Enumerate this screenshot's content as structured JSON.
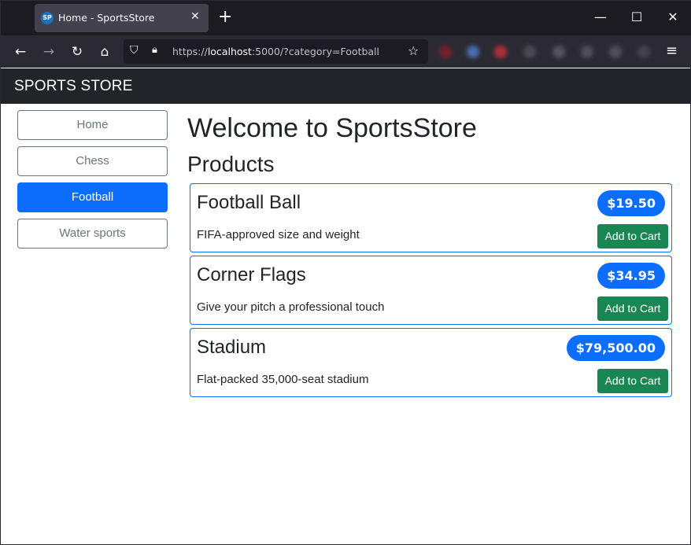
{
  "browser": {
    "tab_title": "Home - SportsStore",
    "favicon_text": "SP",
    "url_host": "localhost",
    "url_prefix": "https://",
    "url_suffix": ":5000/?category=Football"
  },
  "app": {
    "brand": "SPORTS STORE",
    "welcome": "Welcome to SportsStore",
    "products_heading": "Products"
  },
  "categories": [
    {
      "label": "Home",
      "active": false
    },
    {
      "label": "Chess",
      "active": false
    },
    {
      "label": "Football",
      "active": true
    },
    {
      "label": "Water sports",
      "active": false
    }
  ],
  "products": [
    {
      "name": "Football Ball",
      "price": "$19.50",
      "description": "FIFA-approved size and weight",
      "button": "Add to Cart"
    },
    {
      "name": "Corner Flags",
      "price": "$34.95",
      "description": "Give your pitch a professional touch",
      "button": "Add to Cart"
    },
    {
      "name": "Stadium",
      "price": "$79,500.00",
      "description": "Flat-packed 35,000-seat stadium",
      "button": "Add to Cart"
    }
  ],
  "colors": {
    "primary": "#0d6efd",
    "success": "#198754",
    "dark": "#212529",
    "secondary": "#6c757d"
  }
}
